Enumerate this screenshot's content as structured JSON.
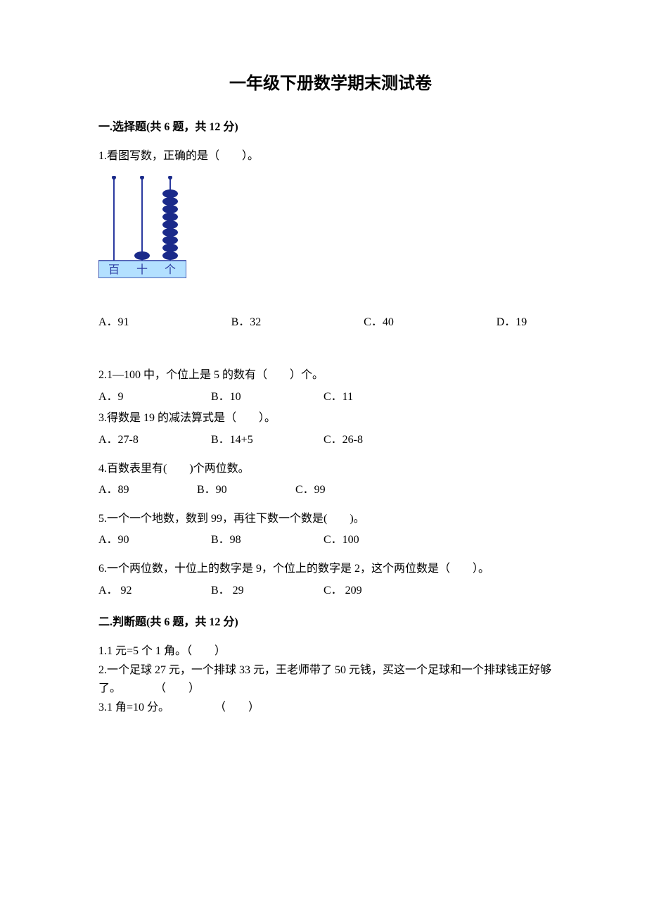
{
  "title": "一年级下册数学期末测试卷",
  "section1": {
    "header": "一.选择题(共 6 题，共 12 分)",
    "q1": {
      "text": "1.看图写数，正确的是（　　）。",
      "optA": "A．91",
      "optB": "B．32",
      "optC": "C．40",
      "optD": "D．19",
      "abacus_labels": {
        "bai": "百",
        "shi": "十",
        "ge": "个"
      }
    },
    "q2": {
      "text": "2.1—100 中，个位上是 5 的数有（　　）个。",
      "optA": "A．9",
      "optB": "B．10",
      "optC": "C．11"
    },
    "q3": {
      "text": "3.得数是 19 的减法算式是（　　）。",
      "optA": "A．27-8",
      "optB": "B．14+5",
      "optC": "C．26-8"
    },
    "q4": {
      "text": "4.百数表里有(　　)个两位数。",
      "optA": "A．89",
      "optB": "B．90",
      "optC": "C．99"
    },
    "q5": {
      "text": "5.一个一个地数，数到 99，再往下数一个数是(　　)。",
      "optA": "A．90",
      "optB": "B．98",
      "optC": "C．100"
    },
    "q6": {
      "text": "6.一个两位数，十位上的数字是 9，个位上的数字是 2，这个两位数是（　　）。",
      "optA": "A． 92",
      "optB": "B． 29",
      "optC": "C． 209"
    }
  },
  "section2": {
    "header": "二.判断题(共 6 题，共 12 分)",
    "q1": "1.1 元=5 个 1 角。（　　）",
    "q2": "2.一个足球 27 元，一个排球 33 元，王老师带了 50 元钱，买这一个足球和一个排球钱正好够了。　　　　（　　）",
    "q3": "3.1 角=10 分。　　　　　（　　）"
  }
}
